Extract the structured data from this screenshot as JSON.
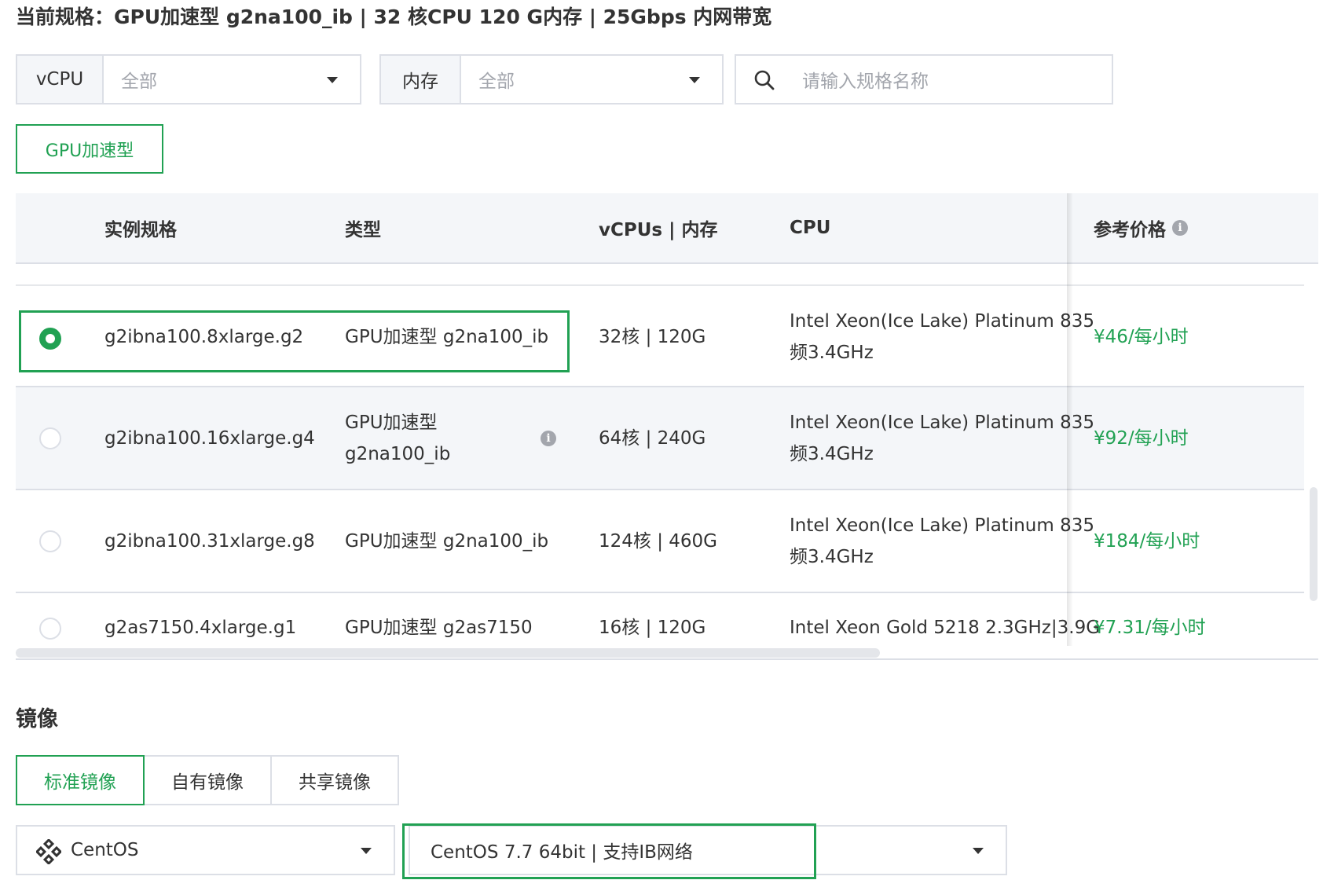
{
  "spec_summary": "当前规格：GPU加速型 g2na100_ib | 32 核CPU 120 G内存 | 25Gbps 内网带宽",
  "filters": {
    "vcpu": {
      "label": "vCPU",
      "value": "全部"
    },
    "memory": {
      "label": "内存",
      "value": "全部"
    },
    "search_placeholder": "请输入规格名称"
  },
  "category_tag": "GPU加速型",
  "table": {
    "headers": {
      "spec": "实例规格",
      "type": "类型",
      "vcpu_mem": "vCPUs | 内存",
      "cpu": "CPU",
      "price": "参考价格"
    },
    "rows": [
      {
        "selected": true,
        "spec": "g2ibna100.8xlarge.g2",
        "type": "GPU加速型 g2na100_ib",
        "vcpu_mem": "32核 | 120G",
        "cpu_line1": "Intel Xeon(Ice Lake) Platinum 835",
        "cpu_line2": "频3.4GHz",
        "price": "¥46/每小时"
      },
      {
        "selected": false,
        "spec": "g2ibna100.16xlarge.g4",
        "type_line1": "GPU加速型",
        "type_line2": "g2na100_ib",
        "vcpu_mem": "64核 | 240G",
        "cpu_line1": "Intel Xeon(Ice Lake) Platinum 835",
        "cpu_line2": "频3.4GHz",
        "price": "¥92/每小时"
      },
      {
        "selected": false,
        "spec": "g2ibna100.31xlarge.g8",
        "type": "GPU加速型 g2na100_ib",
        "vcpu_mem": "124核 | 460G",
        "cpu_line1": "Intel Xeon(Ice Lake) Platinum 835",
        "cpu_line2": "频3.4GHz",
        "price": "¥184/每小时"
      },
      {
        "selected": false,
        "spec": "g2as7150.4xlarge.g1",
        "type": "GPU加速型 g2as7150",
        "vcpu_mem": "16核 | 120G",
        "cpu_line1": "Intel Xeon Gold 5218 2.3GHz|3.9G",
        "price": "¥7.31/每小时"
      }
    ]
  },
  "image_section": {
    "title": "镜像",
    "tabs": [
      "标准镜像",
      "自有镜像",
      "共享镜像"
    ],
    "os": "CentOS",
    "version": "CentOS 7.7 64bit | 支持IB网络"
  },
  "colors": {
    "accent": "#21a153",
    "border": "#dcdfe6",
    "header_bg": "#f4f6f9"
  }
}
